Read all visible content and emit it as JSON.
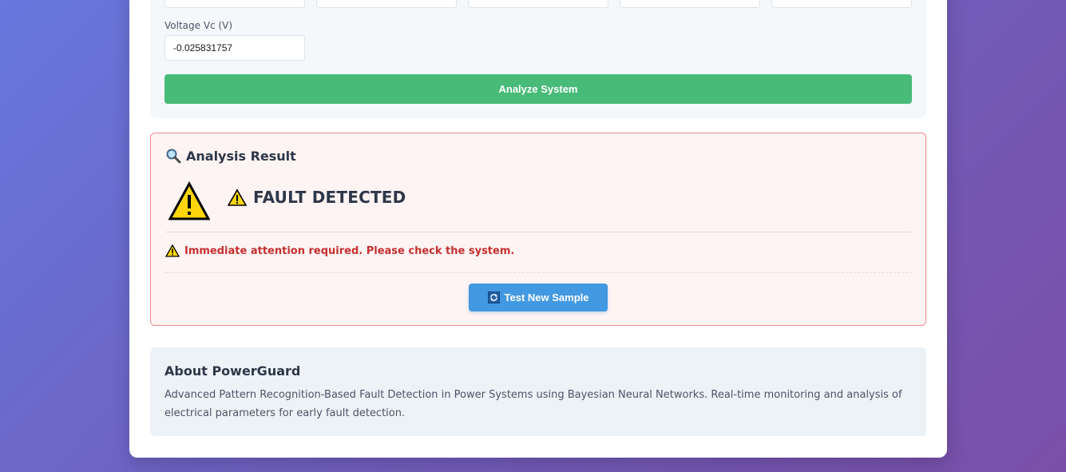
{
  "form": {
    "voltage_vc_label": "Voltage Vc (V)",
    "voltage_vc_value": "-0.025831757",
    "analyze_button": "Analyze System"
  },
  "result": {
    "title": "Analysis Result",
    "status": "FAULT DETECTED",
    "message": "Immediate attention required. Please check the system.",
    "test_button": "Test New Sample",
    "colors": {
      "fault_border": "#f08b8b",
      "fault_bg": "#fff4f4",
      "message": "#c53030"
    }
  },
  "about": {
    "title": "About PowerGuard",
    "description": "Advanced Pattern Recognition-Based Fault Detection in Power Systems using Bayesian Neural Networks. Real-time monitoring and analysis of electrical parameters for early fault detection."
  },
  "colors": {
    "analyze_button": "#48bb78",
    "test_button": "#4299e1"
  },
  "icons": {
    "result_title": "magnifying-glass-icon",
    "status_big": "warning-triangle-icon",
    "status_small": "warning-icon",
    "message": "warning-icon",
    "test_button": "refresh-icon"
  }
}
